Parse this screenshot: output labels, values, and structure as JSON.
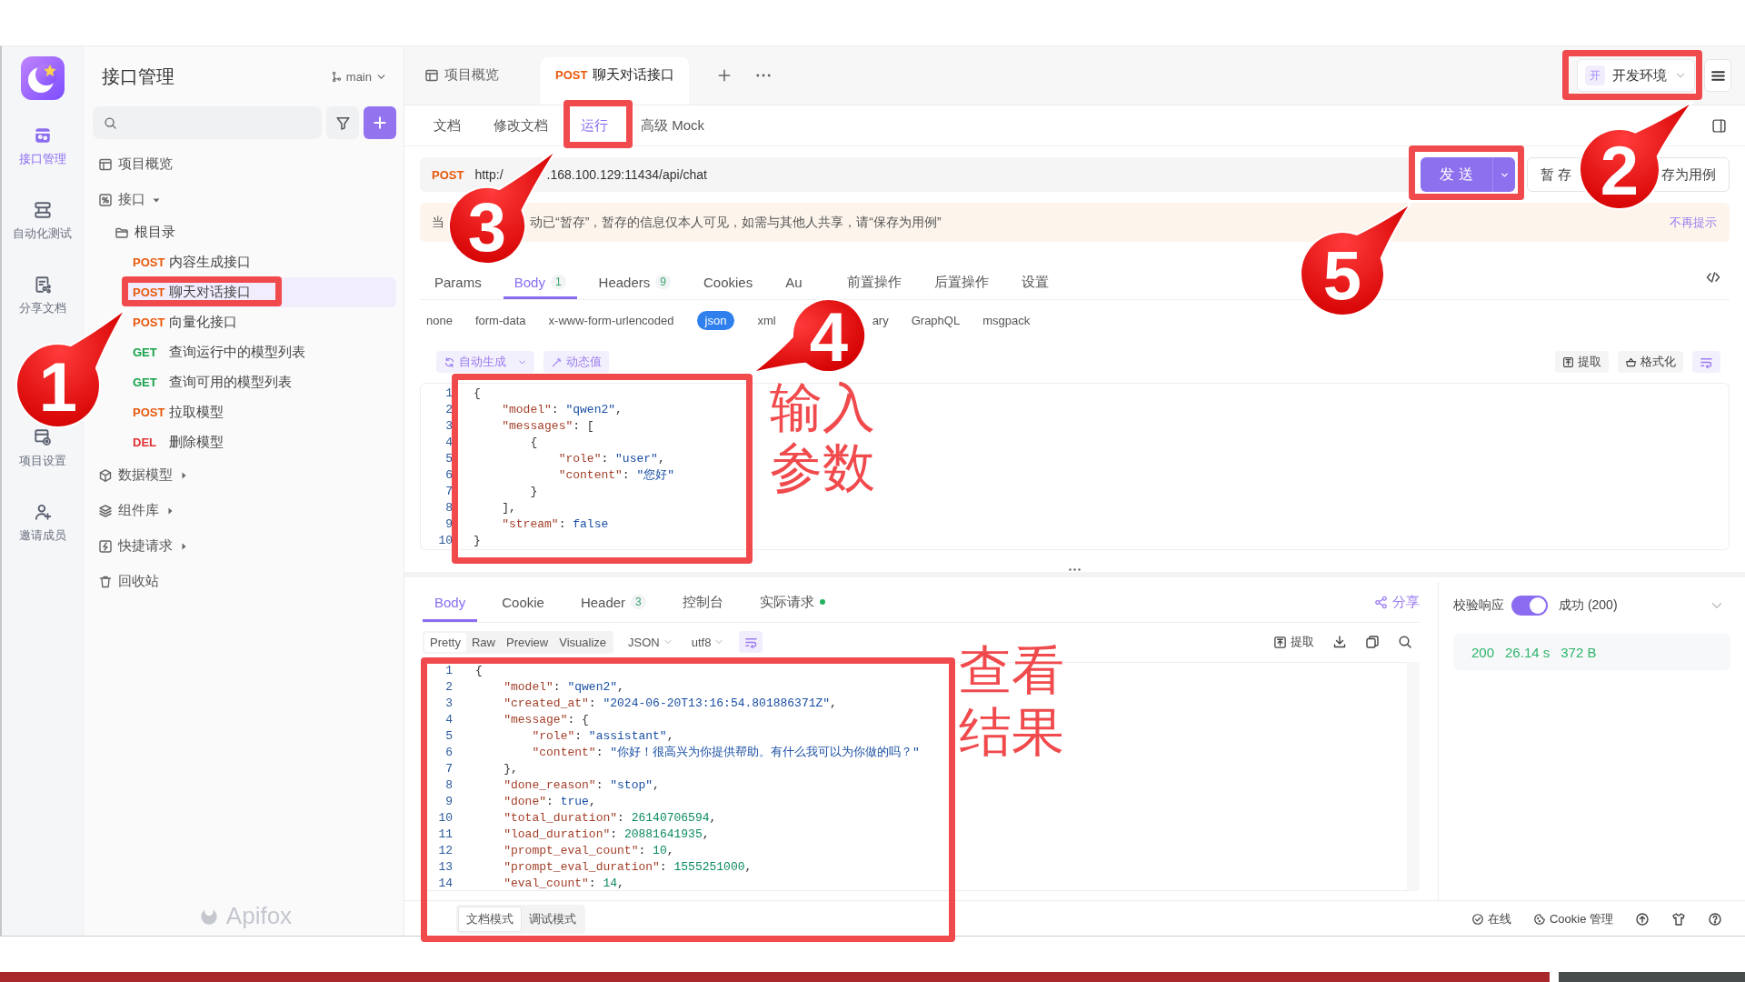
{
  "rail": {
    "items": [
      {
        "label": "接口管理",
        "selected": true
      },
      {
        "label": "自动化测试",
        "selected": false
      },
      {
        "label": "分享文档",
        "selected": false
      },
      {
        "label": "项目设置",
        "selected": false
      },
      {
        "label": "邀请成员",
        "selected": false
      }
    ]
  },
  "sidebar": {
    "title": "接口管理",
    "branch": "main",
    "brand_mark": "Apifox",
    "tree": [
      {
        "label": "项目概览"
      },
      {
        "label": "接口",
        "expanded": true,
        "children": [
          {
            "label": "根目录",
            "children": [
              {
                "method": "POST",
                "color": "#e8590c",
                "label": "内容生成接口",
                "selected": false
              },
              {
                "method": "POST",
                "color": "#e8590c",
                "label": "聊天对话接口",
                "selected": true
              },
              {
                "method": "POST",
                "color": "#e8590c",
                "label": "向量化接口",
                "selected": false
              },
              {
                "method": "GET",
                "color": "#16a34a",
                "label": "查询运行中的模型列表",
                "selected": false
              },
              {
                "method": "GET",
                "color": "#16a34a",
                "label": "查询可用的模型列表",
                "selected": false
              },
              {
                "method": "POST",
                "color": "#e8590c",
                "label": "拉取模型",
                "selected": false
              },
              {
                "method": "DEL",
                "color": "#e03131",
                "label": "删除模型",
                "selected": false
              }
            ]
          }
        ]
      },
      {
        "label": "数据模型",
        "expanded": false
      },
      {
        "label": "组件库",
        "expanded": false
      },
      {
        "label": "快捷请求",
        "expanded": false
      },
      {
        "label": "回收站"
      }
    ]
  },
  "tabs": [
    {
      "label": "项目概览",
      "selected": false
    },
    {
      "method": "POST",
      "label": "聊天对话接口",
      "selected": true
    }
  ],
  "environment": {
    "badge": "开",
    "label": "开发环境"
  },
  "view_tabs": [
    {
      "label": "文档",
      "selected": false
    },
    {
      "label": "修改文档",
      "selected": false
    },
    {
      "label": "运行",
      "selected": true
    },
    {
      "label": "高级 Mock",
      "selected": false
    }
  ],
  "request": {
    "method": "POST",
    "url_start": "http:/",
    "url_end": ".168.100.129:11434/api/chat",
    "send": "发 送",
    "save_draft": "暂 存",
    "save_case": "存为用例"
  },
  "notice": {
    "text_start": "当",
    "text_end": "动已“暂存”，暂存的信息仅本人可见，如需与其他人共享，请“保存为用例”",
    "dismiss": "不再提示"
  },
  "param_tabs": [
    {
      "label": "Params",
      "selected": false
    },
    {
      "label": "Body",
      "count": "1",
      "selected": true
    },
    {
      "label": "Headers",
      "count": "9",
      "selected": false
    },
    {
      "label": "Cookies",
      "selected": false
    },
    {
      "label": "Au",
      "selected": false
    },
    {
      "label": "前置操作",
      "selected": false
    },
    {
      "label": "后置操作",
      "selected": false
    },
    {
      "label": "设置",
      "selected": false
    }
  ],
  "body_types": [
    {
      "label": "none",
      "selected": false
    },
    {
      "label": "form-data",
      "selected": false
    },
    {
      "label": "x-www-form-urlencoded",
      "selected": false
    },
    {
      "label": "json",
      "selected": true
    },
    {
      "label": "xml",
      "selected": false
    },
    {
      "label": "ary",
      "selected": false
    },
    {
      "label": "GraphQL",
      "selected": false
    },
    {
      "label": "msgpack",
      "selected": false
    }
  ],
  "body_tools": {
    "generate": "自动生成",
    "dynamic": "动态值",
    "extract": "提取",
    "format": "格式化"
  },
  "request_body": [
    {
      "n": "1",
      "code": "{"
    },
    {
      "n": "2",
      "code": "    \"model\": \"qwen2\","
    },
    {
      "n": "3",
      "code": "    \"messages\": ["
    },
    {
      "n": "4",
      "code": "        {"
    },
    {
      "n": "5",
      "code": "            \"role\": \"user\","
    },
    {
      "n": "6",
      "code": "            \"content\": \"您好\""
    },
    {
      "n": "7",
      "code": "        }"
    },
    {
      "n": "8",
      "code": "    ],"
    },
    {
      "n": "9",
      "code": "    \"stream\": false"
    },
    {
      "n": "10",
      "code": "}"
    }
  ],
  "response": {
    "tabs": [
      {
        "label": "Body",
        "selected": true
      },
      {
        "label": "Cookie",
        "selected": false
      },
      {
        "label": "Header",
        "count": "3",
        "selected": false
      },
      {
        "label": "控制台",
        "selected": false
      },
      {
        "label": "实际请求",
        "selected": false,
        "color": "#22b35e"
      }
    ],
    "share": "分享",
    "views": [
      {
        "label": "Pretty",
        "selected": true
      },
      {
        "label": "Raw",
        "selected": false
      },
      {
        "label": "Preview",
        "selected": false
      },
      {
        "label": "Visualize",
        "selected": false
      }
    ],
    "format": "JSON",
    "encoding": "utf8",
    "extract": "提取",
    "lines": [
      {
        "n": "1",
        "code": "{"
      },
      {
        "n": "2",
        "code": "    \"model\": \"qwen2\","
      },
      {
        "n": "3",
        "code": "    \"created_at\": \"2024-06-20T13:16:54.801886371Z\","
      },
      {
        "n": "4",
        "code": "    \"message\": {"
      },
      {
        "n": "5",
        "code": "        \"role\": \"assistant\","
      },
      {
        "n": "6",
        "code": "        \"content\": \"你好！很高兴为你提供帮助。有什么我可以为你做的吗？\""
      },
      {
        "n": "7",
        "code": "    },"
      },
      {
        "n": "8",
        "code": "    \"done_reason\": \"stop\","
      },
      {
        "n": "9",
        "code": "    \"done\": true,"
      },
      {
        "n": "10",
        "code": "    \"total_duration\": 26140706594,"
      },
      {
        "n": "11",
        "code": "    \"load_duration\": 20881641935,"
      },
      {
        "n": "12",
        "code": "    \"prompt_eval_count\": 10,"
      },
      {
        "n": "13",
        "code": "    \"prompt_eval_duration\": 1555251000,"
      },
      {
        "n": "14",
        "code": "    \"eval_count\": 14,"
      }
    ],
    "modes": [
      {
        "label": "文档模式",
        "selected": true
      },
      {
        "label": "调试模式",
        "selected": false
      }
    ]
  },
  "validation": {
    "label": "校验响应",
    "on": true,
    "result": "成功 (200)",
    "status": "200",
    "time": "26.14 s",
    "size": "372 B"
  },
  "status_bar": {
    "online": "在线",
    "cookies": "Cookie 管理"
  },
  "annotations": {
    "callouts": [
      {
        "number": "1"
      },
      {
        "number": "2"
      },
      {
        "number": "3"
      },
      {
        "number": "4"
      },
      {
        "number": "5"
      }
    ],
    "notes": [
      {
        "text": "输入参数"
      },
      {
        "text": "查看结果"
      }
    ]
  }
}
